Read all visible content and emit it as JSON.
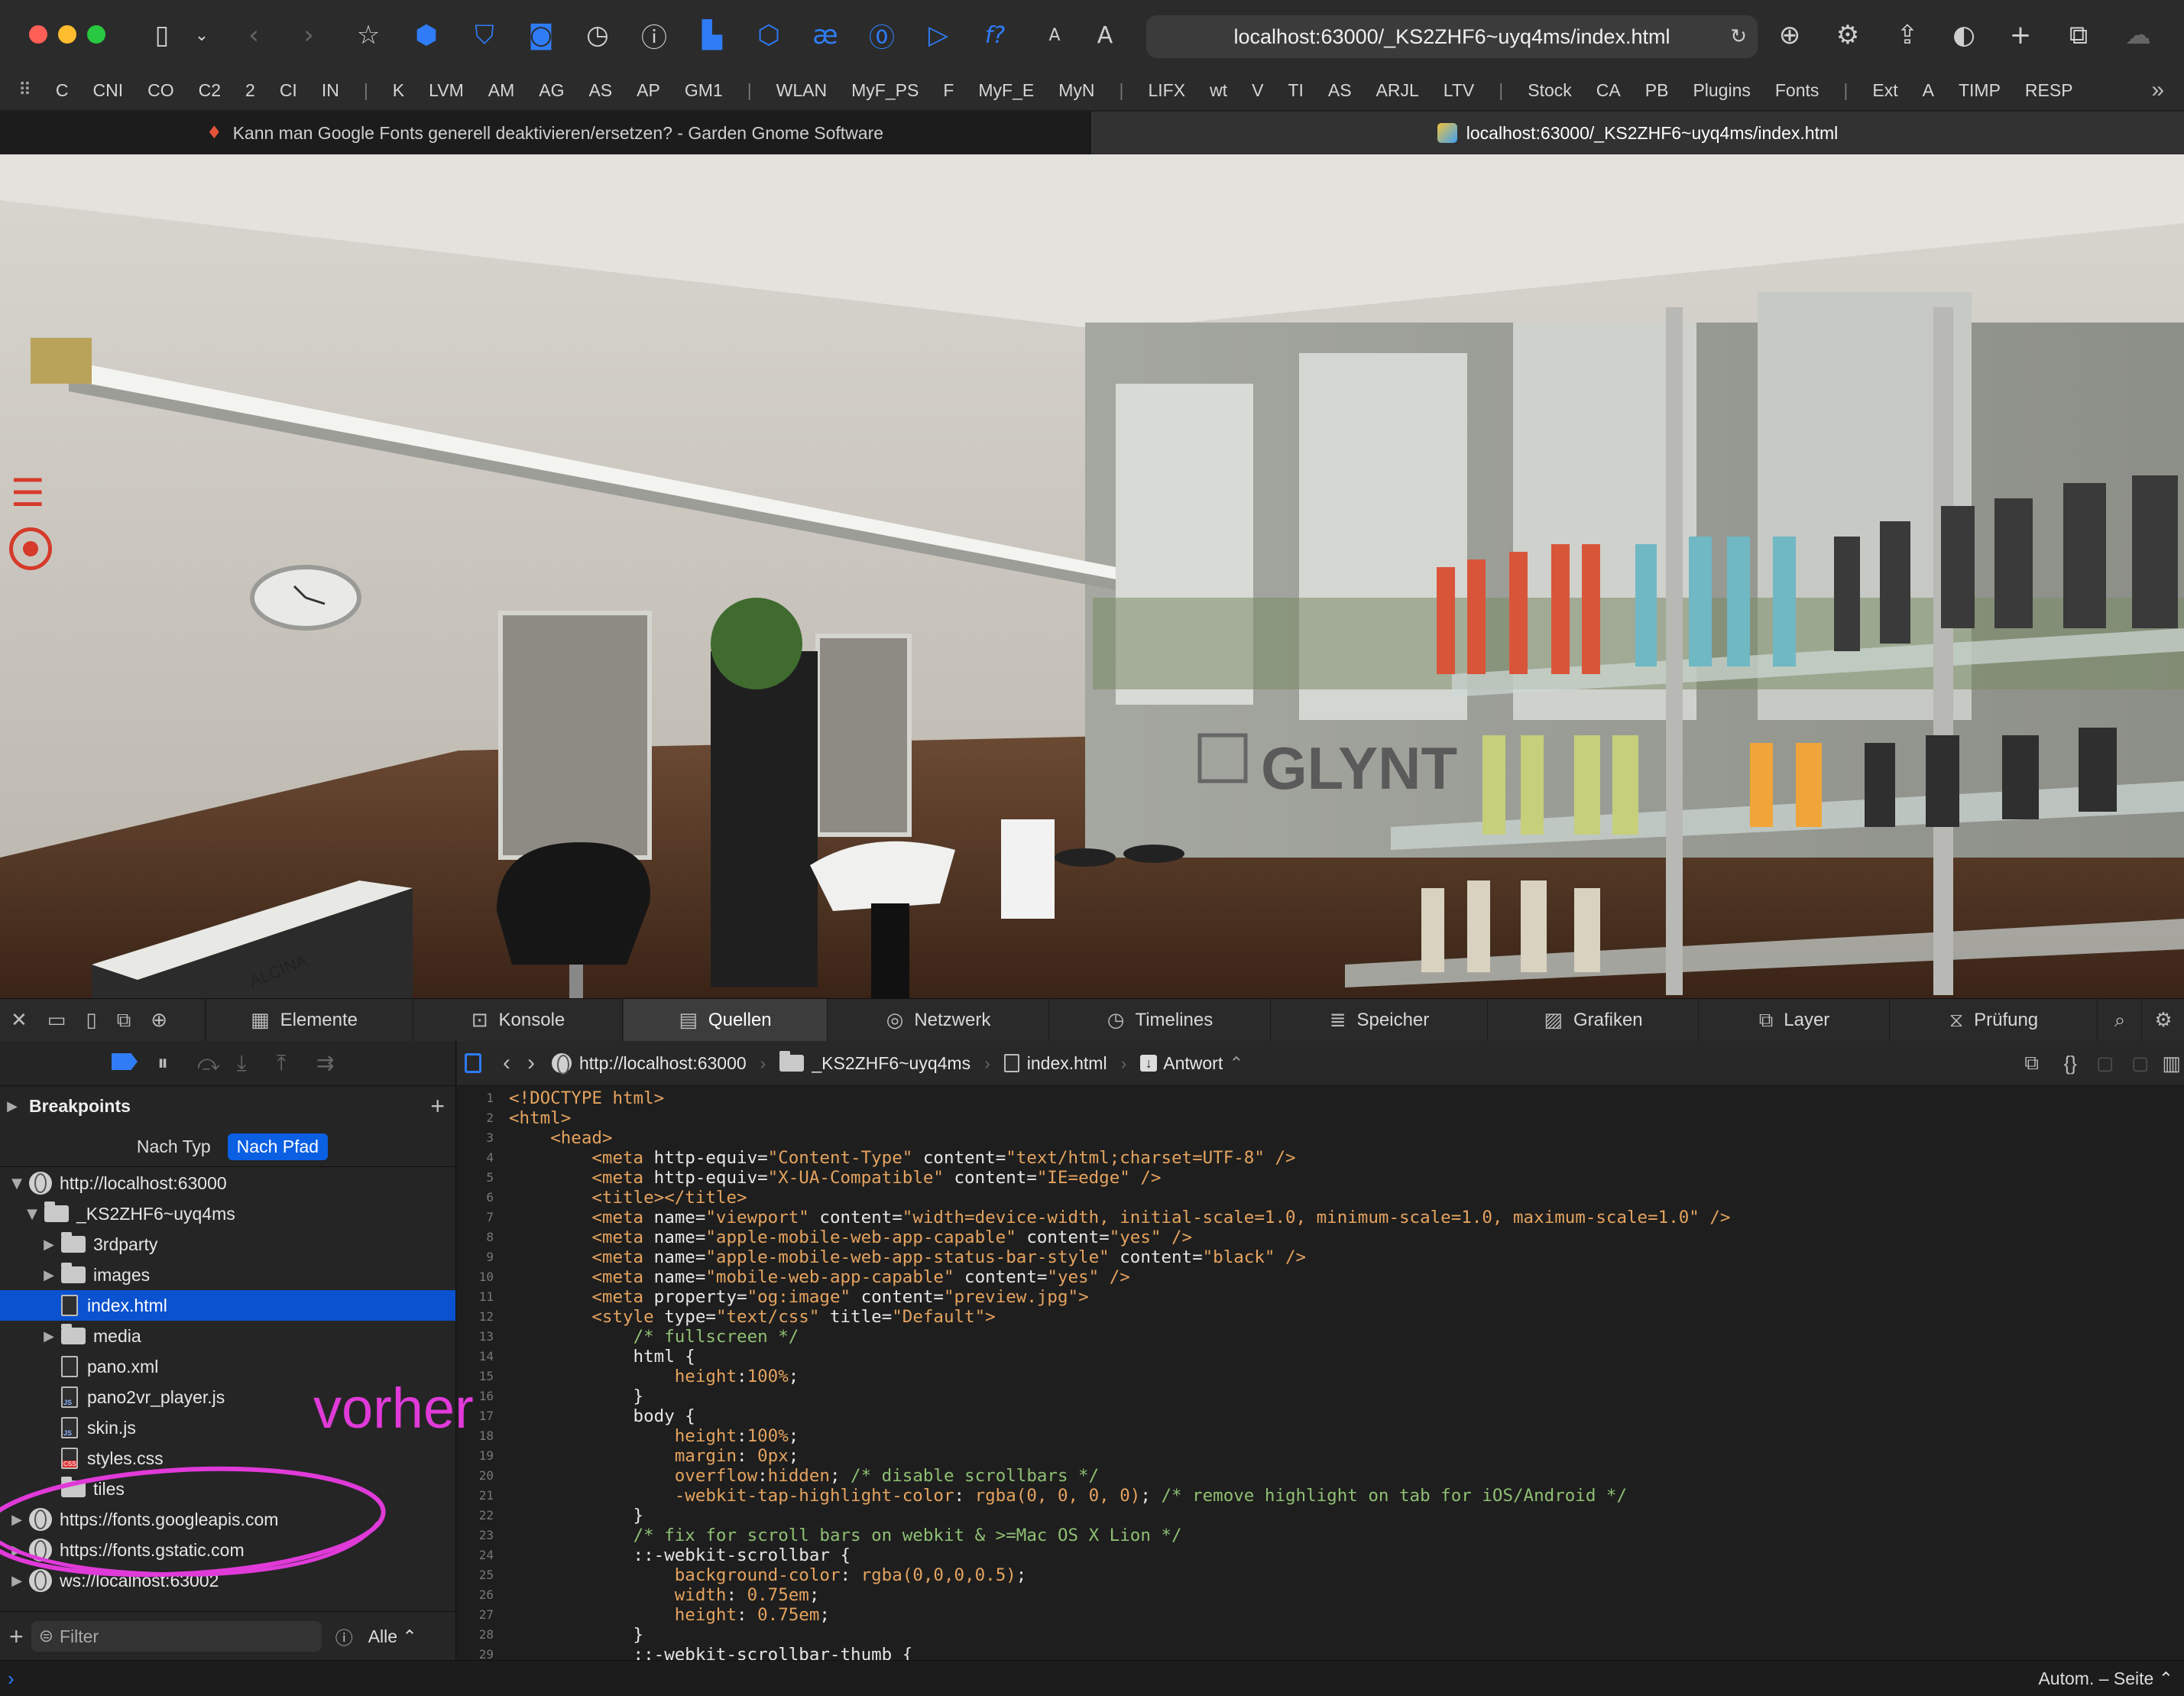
{
  "browser": {
    "url": "localhost:63000/_KS2ZHF6~uyq4ms/index.html",
    "favorites": [
      "C",
      "CNI",
      "CO",
      "C2",
      "2",
      "CI",
      "IN",
      "|",
      "K",
      "LVM",
      "AM",
      "AG",
      "AS",
      "AP",
      "GM1",
      "|",
      "WLAN",
      "MyF_PS",
      "F",
      "MyF_E",
      "MyN",
      "|",
      "LIFX",
      "wt",
      "V",
      "TI",
      "AS",
      "ARJL",
      "LTV",
      "|",
      "Stock",
      "CA",
      "PB",
      "Plugins",
      "Fonts",
      "|",
      "Ext",
      "A",
      "TIMP",
      "RESP"
    ],
    "tabs": [
      {
        "title": "Kann man Google Fonts generell deaktivieren/ersetzen? - Garden Gnome Software"
      },
      {
        "title": "localhost:63000/_KS2ZHF6~uyq4ms/index.html"
      }
    ]
  },
  "pano": {
    "brand_text": "GLYNT",
    "brand_text_2": "ALCINA"
  },
  "devtools": {
    "tabs": [
      "Elemente",
      "Konsole",
      "Quellen",
      "Netzwerk",
      "Timelines",
      "Speicher",
      "Grafiken",
      "Layer",
      "Prüfung"
    ],
    "breakpoints_label": "Breakpoints",
    "sort_by_type": "Nach Typ",
    "sort_by_path": "Nach Pfad",
    "tree": [
      {
        "label": "http://localhost:63000",
        "kind": "globe",
        "level": 0,
        "open": true
      },
      {
        "label": "_KS2ZHF6~uyq4ms",
        "kind": "folder",
        "level": 1,
        "open": true
      },
      {
        "label": "3rdparty",
        "kind": "folder",
        "level": 2,
        "open": false
      },
      {
        "label": "images",
        "kind": "folder",
        "level": 2,
        "open": false
      },
      {
        "label": "index.html",
        "kind": "html",
        "level": 2,
        "selected": true
      },
      {
        "label": "media",
        "kind": "folder",
        "level": 2,
        "open": false
      },
      {
        "label": "pano.xml",
        "kind": "file",
        "level": 2
      },
      {
        "label": "pano2vr_player.js",
        "kind": "js",
        "level": 2
      },
      {
        "label": "skin.js",
        "kind": "js",
        "level": 2
      },
      {
        "label": "styles.css",
        "kind": "css",
        "level": 2
      },
      {
        "label": "tiles",
        "kind": "folder",
        "level": 2
      },
      {
        "label": "https://fonts.googleapis.com",
        "kind": "globe",
        "level": 0,
        "open": false
      },
      {
        "label": "https://fonts.gstatic.com",
        "kind": "globe",
        "level": 0,
        "open": false
      },
      {
        "label": "ws://localhost:63002",
        "kind": "globe",
        "level": 0,
        "open": false
      }
    ],
    "filter_placeholder": "Filter",
    "filter_scope": "Alle",
    "path": {
      "host": "http://localhost:63000",
      "folder": "_KS2ZHF6~uyq4ms",
      "file": "index.html",
      "mode": "Antwort"
    },
    "code_lines": [
      [
        [
          "tag",
          "<!DOCTYPE html>"
        ]
      ],
      [
        [
          "tag",
          "<html>"
        ]
      ],
      [
        [
          "plain",
          "    "
        ],
        [
          "tag",
          "<head>"
        ]
      ],
      [
        [
          "plain",
          "        "
        ],
        [
          "tag",
          "<meta "
        ],
        [
          "attr",
          "http-equiv="
        ],
        [
          "str",
          "\"Content-Type\""
        ],
        [
          "attr",
          " content="
        ],
        [
          "str",
          "\"text/html;charset=UTF-8\""
        ],
        [
          "tag",
          " />"
        ]
      ],
      [
        [
          "plain",
          "        "
        ],
        [
          "tag",
          "<meta "
        ],
        [
          "attr",
          "http-equiv="
        ],
        [
          "str",
          "\"X-UA-Compatible\""
        ],
        [
          "attr",
          " content="
        ],
        [
          "str",
          "\"IE=edge\""
        ],
        [
          "tag",
          " />"
        ]
      ],
      [
        [
          "plain",
          "        "
        ],
        [
          "tag",
          "<title></title>"
        ]
      ],
      [
        [
          "plain",
          "        "
        ],
        [
          "tag",
          "<meta "
        ],
        [
          "attr",
          "name="
        ],
        [
          "str",
          "\"viewport\""
        ],
        [
          "attr",
          " content="
        ],
        [
          "str",
          "\"width=device-width, initial-scale=1.0, minimum-scale=1.0, maximum-scale=1.0\""
        ],
        [
          "tag",
          " />"
        ]
      ],
      [
        [
          "plain",
          "        "
        ],
        [
          "tag",
          "<meta "
        ],
        [
          "attr",
          "name="
        ],
        [
          "str",
          "\"apple-mobile-web-app-capable\""
        ],
        [
          "attr",
          " content="
        ],
        [
          "str",
          "\"yes\""
        ],
        [
          "tag",
          " />"
        ]
      ],
      [
        [
          "plain",
          "        "
        ],
        [
          "tag",
          "<meta "
        ],
        [
          "attr",
          "name="
        ],
        [
          "str",
          "\"apple-mobile-web-app-status-bar-style\""
        ],
        [
          "attr",
          " content="
        ],
        [
          "str",
          "\"black\""
        ],
        [
          "tag",
          " />"
        ]
      ],
      [
        [
          "plain",
          "        "
        ],
        [
          "tag",
          "<meta "
        ],
        [
          "attr",
          "name="
        ],
        [
          "str",
          "\"mobile-web-app-capable\""
        ],
        [
          "attr",
          " content="
        ],
        [
          "str",
          "\"yes\""
        ],
        [
          "tag",
          " />"
        ]
      ],
      [
        [
          "plain",
          "        "
        ],
        [
          "tag",
          "<meta "
        ],
        [
          "attr",
          "property="
        ],
        [
          "str",
          "\"og:image\""
        ],
        [
          "attr",
          " content="
        ],
        [
          "str",
          "\"preview.jpg\""
        ],
        [
          "tag",
          ">"
        ]
      ],
      [
        [
          "plain",
          "        "
        ],
        [
          "tag",
          "<style "
        ],
        [
          "attr",
          "type="
        ],
        [
          "str",
          "\"text/css\""
        ],
        [
          "attr",
          " title="
        ],
        [
          "str",
          "\"Default\""
        ],
        [
          "tag",
          ">"
        ]
      ],
      [
        [
          "plain",
          "            "
        ],
        [
          "cmt",
          "/* fullscreen */"
        ]
      ],
      [
        [
          "plain",
          "            html {"
        ]
      ],
      [
        [
          "plain",
          "                "
        ],
        [
          "tag",
          "height"
        ],
        [
          "plain",
          ":"
        ],
        [
          "str",
          "100%"
        ],
        [
          "plain",
          ";"
        ]
      ],
      [
        [
          "plain",
          "            }"
        ]
      ],
      [
        [
          "plain",
          "            body {"
        ]
      ],
      [
        [
          "plain",
          "                "
        ],
        [
          "tag",
          "height"
        ],
        [
          "plain",
          ":"
        ],
        [
          "str",
          "100%"
        ],
        [
          "plain",
          ";"
        ]
      ],
      [
        [
          "plain",
          "                "
        ],
        [
          "tag",
          "margin"
        ],
        [
          "plain",
          ": "
        ],
        [
          "str",
          "0px"
        ],
        [
          "plain",
          ";"
        ]
      ],
      [
        [
          "plain",
          "                "
        ],
        [
          "tag",
          "overflow"
        ],
        [
          "plain",
          ":"
        ],
        [
          "str",
          "hidden"
        ],
        [
          "plain",
          "; "
        ],
        [
          "cmt",
          "/* disable scrollbars */"
        ]
      ],
      [
        [
          "plain",
          "                "
        ],
        [
          "tag",
          "-webkit-tap-highlight-color"
        ],
        [
          "plain",
          ": "
        ],
        [
          "str",
          "rgba(0, 0, 0, 0)"
        ],
        [
          "plain",
          "; "
        ],
        [
          "cmt",
          "/* remove highlight on tab for iOS/Android */"
        ]
      ],
      [
        [
          "plain",
          "            }"
        ]
      ],
      [
        [
          "plain",
          "            "
        ],
        [
          "cmt",
          "/* fix for scroll bars on webkit & >=Mac OS X Lion */"
        ]
      ],
      [
        [
          "plain",
          "            ::-webkit-scrollbar {"
        ]
      ],
      [
        [
          "plain",
          "                "
        ],
        [
          "tag",
          "background-color"
        ],
        [
          "plain",
          ": "
        ],
        [
          "str",
          "rgba(0,0,0,0.5)"
        ],
        [
          "plain",
          ";"
        ]
      ],
      [
        [
          "plain",
          "                "
        ],
        [
          "tag",
          "width"
        ],
        [
          "plain",
          ": "
        ],
        [
          "str",
          "0.75em"
        ],
        [
          "plain",
          ";"
        ]
      ],
      [
        [
          "plain",
          "                "
        ],
        [
          "tag",
          "height"
        ],
        [
          "plain",
          ": "
        ],
        [
          "str",
          "0.75em"
        ],
        [
          "plain",
          ";"
        ]
      ],
      [
        [
          "plain",
          "            }"
        ]
      ],
      [
        [
          "plain",
          "            ::-webkit-scrollbar-thumb {"
        ]
      ]
    ],
    "status_right": "Autom. – Seite"
  },
  "annotation": {
    "text": "vorher",
    "color": "#e03ad9"
  },
  "colors": {
    "accent": "#0a5fe3",
    "pano_hotspot": "#d63a2a"
  }
}
